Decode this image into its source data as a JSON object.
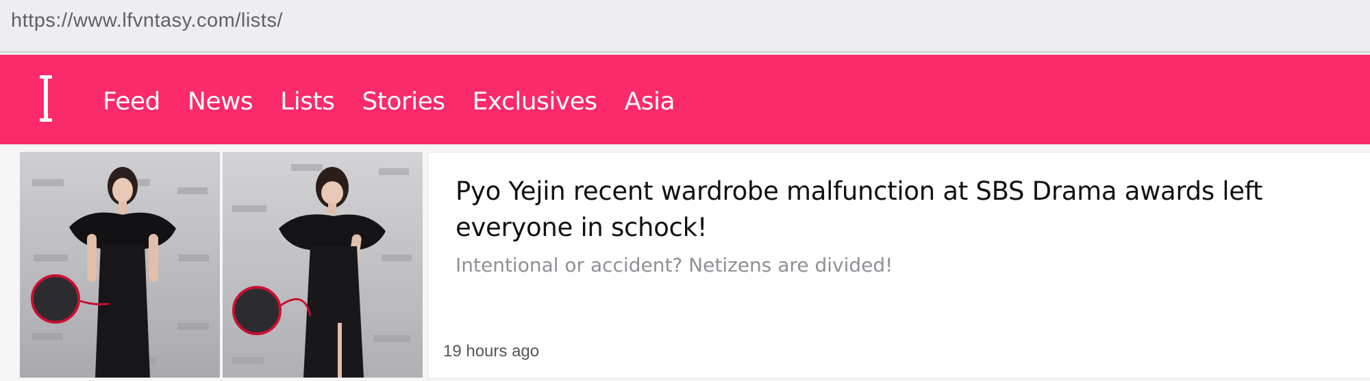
{
  "browser": {
    "url": "https://www.lfvntasy.com/lists/"
  },
  "navbar": {
    "color": "#fb2a6a",
    "logo_icon": "serif-i-logo",
    "items": [
      {
        "label": "Feed"
      },
      {
        "label": "News"
      },
      {
        "label": "Lists"
      },
      {
        "label": "Stories"
      },
      {
        "label": "Exclusives"
      },
      {
        "label": "Asia"
      }
    ]
  },
  "article": {
    "headline": "Pyo Yejin recent wardrobe malfunction at SBS Drama awards left everyone in schock!",
    "subtitle": "Intentional or accident? Netizens are divided!",
    "timestamp": "19 hours ago"
  }
}
